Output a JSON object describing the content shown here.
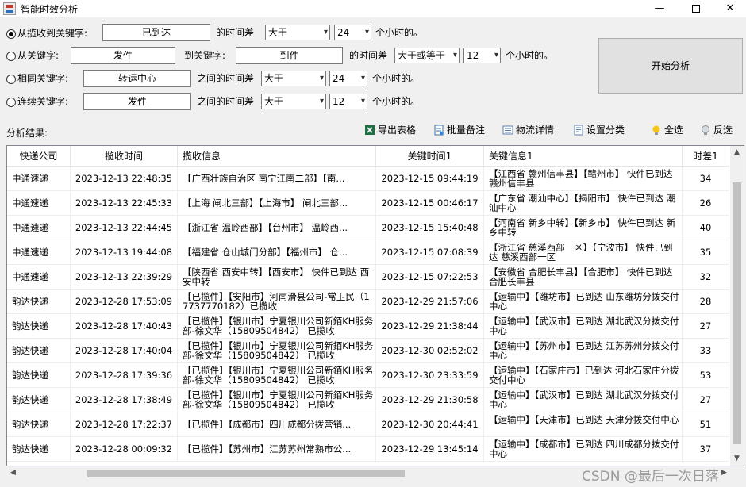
{
  "window": {
    "title": "智能时效分析",
    "min": "—",
    "close": "✕"
  },
  "options": [
    {
      "label": "从揽收到关键字:",
      "key": "已到达",
      "mid": "的时间差",
      "op": "大于",
      "hours": "24",
      "unit": "个小时的。",
      "checked": true
    },
    {
      "label": "从关键字:",
      "key_from": "发件",
      "to_label": "到关键字:",
      "key_to": "到件",
      "mid": "的时间差",
      "op": "大于或等于",
      "hours": "12",
      "unit": "个小时的。",
      "checked": false
    },
    {
      "label": "相同关键字:",
      "key": "转运中心",
      "mid": "之间的时间差",
      "op": "大于",
      "hours": "24",
      "unit": "个小时的。",
      "checked": false
    },
    {
      "label": "连续关键字:",
      "key": "发件",
      "mid": "之间的时间差",
      "op": "大于",
      "hours": "12",
      "unit": "个小时的。",
      "checked": false
    }
  ],
  "start_button": "开始分析",
  "results_label": "分析结果:",
  "toolbar": {
    "export": "导出表格",
    "batch_note": "批量备注",
    "logistics": "物流详情",
    "set_category": "设置分类",
    "select_all": "全选",
    "invert": "反选"
  },
  "columns": [
    "快递公司",
    "揽收时间",
    "揽收信息",
    "关键时间1",
    "关键信息1",
    "时差1"
  ],
  "rows": [
    {
      "company": "中通速递",
      "pickup_time": "2023-12-13 22:48:35",
      "pickup_info": "【广西壮族自治区 南宁江南二部】【南...",
      "key_time": "2023-12-15 09:44:19",
      "key_info": "【江西省 赣州信丰县】【赣州市】 快件已到达 赣州信丰县",
      "diff": "34"
    },
    {
      "company": "中通速递",
      "pickup_time": "2023-12-13 22:45:33",
      "pickup_info": "【上海 闸北三部】【上海市】 闸北三部...",
      "key_time": "2023-12-15 00:46:17",
      "key_info": "【广东省 潮汕中心】【揭阳市】 快件已到达 潮汕中心",
      "diff": "26"
    },
    {
      "company": "中通速递",
      "pickup_time": "2023-12-13 22:44:45",
      "pickup_info": "【浙江省 温岭西部】【台州市】 温岭西...",
      "key_time": "2023-12-15 15:40:48",
      "key_info": "【河南省 新乡中转】【新乡市】 快件已到达 新乡中转",
      "diff": "40"
    },
    {
      "company": "中通速递",
      "pickup_time": "2023-12-13 19:44:08",
      "pickup_info": "【福建省 仓山城门分部】【福州市】 仓...",
      "key_time": "2023-12-15 07:08:39",
      "key_info": "【浙江省 慈溪西部一区】【宁波市】 快件已到达 慈溪西部一区",
      "diff": "35"
    },
    {
      "company": "中通速递",
      "pickup_time": "2023-12-13 22:39:29",
      "pickup_info": "【陕西省 西安中转】【西安市】 快件已到达 西安中转",
      "key_time": "2023-12-15 07:22:53",
      "key_info": "【安徽省 合肥长丰县】【合肥市】 快件已到达 合肥长丰县",
      "diff": "32"
    },
    {
      "company": "韵达快递",
      "pickup_time": "2023-12-28 17:53:09",
      "pickup_info": "【已揽件】【安阳市】河南滑县公司-常卫民（17737770182）已揽收",
      "key_time": "2023-12-29 21:57:06",
      "key_info": "【运输中】【潍坊市】已到达 山东潍坊分拨交付中心",
      "diff": "28"
    },
    {
      "company": "韵达快递",
      "pickup_time": "2023-12-28 17:40:43",
      "pickup_info": "【已揽件】【银川市】宁夏银川公司新銆KH服务部-徐文华（15809504842） 已揽收",
      "key_time": "2023-12-29 21:38:44",
      "key_info": "【运输中】【武汉市】已到达 湖北武汉分拨交付中心",
      "diff": "27"
    },
    {
      "company": "韵达快递",
      "pickup_time": "2023-12-28 17:40:04",
      "pickup_info": "【已揽件】【银川市】宁夏银川公司新銆KH服务部-徐文华（15809504842） 已揽收",
      "key_time": "2023-12-30 02:52:02",
      "key_info": "【运输中】【苏州市】已到达 江苏苏州分拨交付中心",
      "diff": "33"
    },
    {
      "company": "韵达快递",
      "pickup_time": "2023-12-28 17:39:36",
      "pickup_info": "【已揽件】【银川市】宁夏银川公司新銆KH服务部-徐文华（15809504842） 已揽收",
      "key_time": "2023-12-30 23:33:59",
      "key_info": "【运输中】【石家庄市】已到达 河北石家庄分拨交付中心",
      "diff": "53"
    },
    {
      "company": "韵达快递",
      "pickup_time": "2023-12-28 17:38:49",
      "pickup_info": "【已揽件】【银川市】宁夏银川公司新銆KH服务部-徐文华（15809504842） 已揽收",
      "key_time": "2023-12-29 21:30:58",
      "key_info": "【运输中】【武汉市】已到达 湖北武汉分拨交付中心",
      "diff": "27"
    },
    {
      "company": "韵达快递",
      "pickup_time": "2023-12-28 17:22:37",
      "pickup_info": "【已揽件】【成都市】四川成都分拨营销...",
      "key_time": "2023-12-30 20:44:41",
      "key_info": "【运输中】【天津市】已到达 天津分拨交付中心",
      "diff": "51"
    },
    {
      "company": "韵达快递",
      "pickup_time": "2023-12-28 00:09:32",
      "pickup_info": "【已揽件】【苏州市】江苏苏州常熟市公...",
      "key_time": "2023-12-29 13:45:14",
      "key_info": "【运输中】【成都市】已到达 四川成都分拨交付中心",
      "diff": "37"
    }
  ],
  "watermark": "CSDN @最后一次日落"
}
